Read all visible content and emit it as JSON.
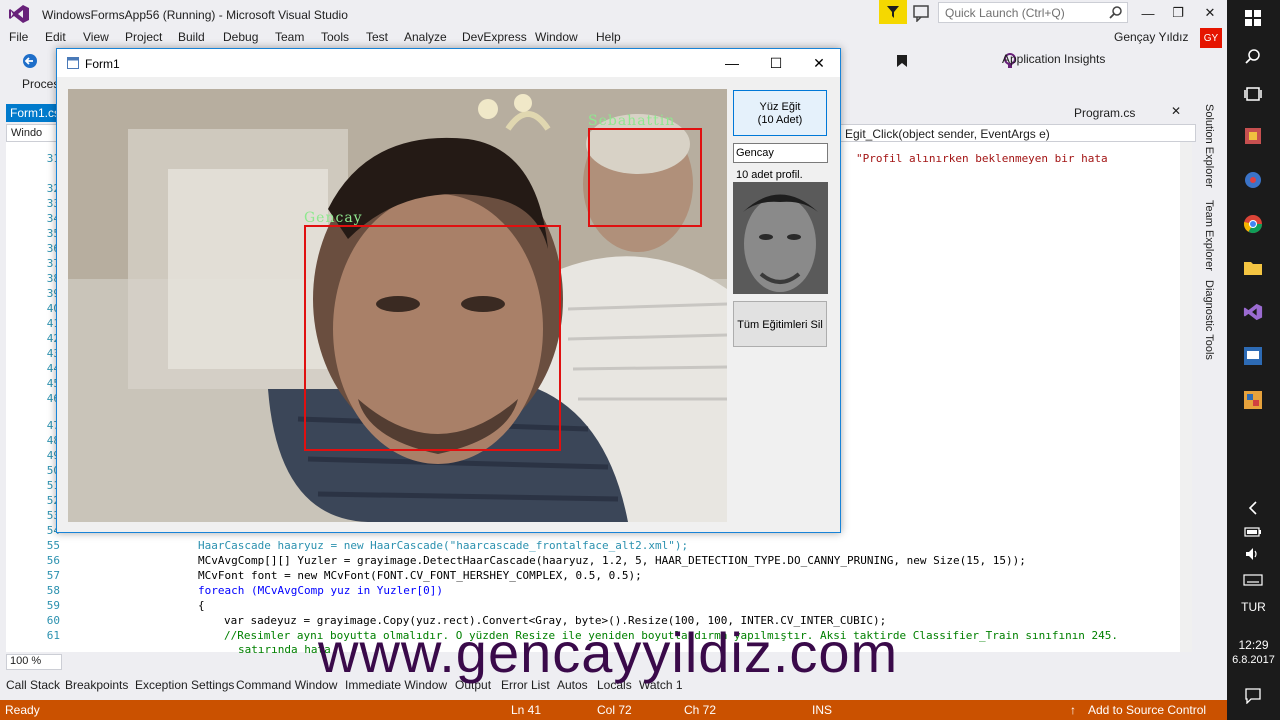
{
  "vs": {
    "title": "WindowsFormsApp56 (Running) - Microsoft Visual Studio",
    "quick_launch_placeholder": "Quick Launch (Ctrl+Q)",
    "user_name": "Gençay Yıldız",
    "user_initials": "GY",
    "menu": [
      "File",
      "Edit",
      "View",
      "Project",
      "Build",
      "Debug",
      "Team",
      "Tools",
      "Test",
      "Analyze",
      "DevExpress",
      "Window",
      "Help"
    ],
    "toolbar_process_label": "Proces",
    "application_insights": "Application Insights",
    "tabs": {
      "active": "Form1.cs",
      "other": "Program.cs"
    },
    "nav": {
      "class_label": "Windo",
      "method_label": "Egit_Click(object sender, EventArgs e)"
    },
    "zoom": "100 %",
    "side_tabs": [
      "Solution Explorer",
      "Team Explorer",
      "Diagnostic Tools"
    ],
    "tool_tabs": [
      "Call Stack",
      "Breakpoints",
      "Exception Settings",
      "Command Window",
      "Immediate Window",
      "Output",
      "Error List",
      "Autos",
      "Locals",
      "Watch 1"
    ],
    "status": {
      "ready": "Ready",
      "line": "Ln 41",
      "col": "Col 72",
      "ch": "Ch 72",
      "mode": "INS",
      "source_control": "Add to Source Control"
    },
    "code": {
      "line_numbers": [
        "31",
        "32",
        "33",
        "34",
        "35",
        "36",
        "37",
        "38",
        "39",
        "40",
        "41",
        "42",
        "43",
        "44",
        "45",
        "46",
        "47",
        "48",
        "49",
        "50",
        "51",
        "52",
        "53",
        "54",
        "55",
        "56",
        "57",
        "58",
        "59",
        "60",
        "61"
      ],
      "line31_string": "\"Profil alınırken beklenmeyen bir hata",
      "line55": "HaarCascade haaryuz = new HaarCascade(\"haarcascade_frontalface_alt2.xml\");",
      "line56": "MCvAvgComp[][] Yuzler = grayimage.DetectHaarCascade(haaryuz, 1.2, 5, HAAR_DETECTION_TYPE.DO_CANNY_PRUNING, new Size(15, 15));",
      "line57": "MCvFont font = new MCvFont(FONT.CV_FONT_HERSHEY_COMPLEX, 0.5, 0.5);",
      "line58": "foreach (MCvAvgComp yuz in Yuzler[0])",
      "line59": "{",
      "line60": "var sadeyuz = grayimage.Copy(yuz.rect).Convert<Gray, byte>().Resize(100, 100, INTER.CV_INTER_CUBIC);",
      "line61": "//Resimler aynı boyutta olmalıdır. O yüzden Resize ile yeniden boyutlandırma yapılmıştır. Aksi taktirde Classifier_Train sınıfının 245.",
      "line61b": "satırında hata"
    }
  },
  "form1": {
    "title": "Form1",
    "train_button": "Yüz Eğit\n(10 Adet)",
    "name_value": "Gencay",
    "profile_count": "10 adet profil.",
    "clear_button": "Tüm Eğitimleri Sil",
    "detections": [
      {
        "name": "Gencay"
      },
      {
        "name": "Sebahattin"
      }
    ]
  },
  "taskbar": {
    "language": "TUR",
    "time": "12:29",
    "date": "6.8.2017"
  },
  "watermark": "www.gencayyildiz.com",
  "colors": {
    "status_bar": "#ca5100",
    "vs_accent": "#007acc",
    "face_box": "#e01010",
    "face_label": "#8fe88f",
    "filter_icon_bg": "#f5d800"
  }
}
